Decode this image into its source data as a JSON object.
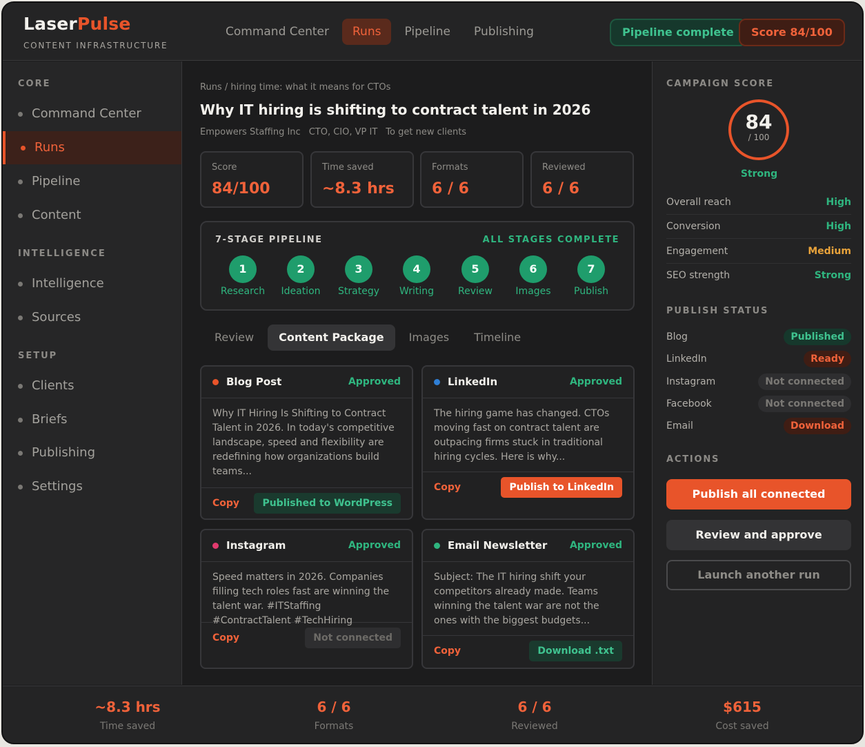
{
  "header": {
    "logo_part1": "Laser",
    "logo_part2": "Pulse",
    "logo_sub": "CONTENT INFRASTRUCTURE",
    "nav": [
      "Command Center",
      "Runs",
      "Pipeline",
      "Publishing"
    ],
    "active_nav": "Runs",
    "badge_pipeline": "Pipeline complete",
    "badge_score": "Score 84/100"
  },
  "sidebar": {
    "sections": [
      {
        "title": "CORE",
        "items": [
          "Command Center",
          "Runs",
          "Pipeline",
          "Content"
        ]
      },
      {
        "title": "INTELLIGENCE",
        "items": [
          "Intelligence",
          "Sources"
        ]
      },
      {
        "title": "SETUP",
        "items": [
          "Clients",
          "Briefs",
          "Publishing",
          "Settings"
        ]
      }
    ],
    "active_item": "Runs"
  },
  "main": {
    "breadcrumb": "Runs / hiring time: what it means for CTOs",
    "title": "Why IT hiring is shifting to contract talent in 2026",
    "meta": [
      "Empowers Staffing Inc",
      "CTO, CIO, VP IT",
      "To get new clients"
    ],
    "stats": [
      {
        "label": "Score",
        "value": "84/100"
      },
      {
        "label": "Time saved",
        "value": "~8.3 hrs"
      },
      {
        "label": "Formats",
        "value": "6 / 6"
      },
      {
        "label": "Reviewed",
        "value": "6 / 6"
      }
    ],
    "pipeline": {
      "title": "7-STAGE PIPELINE",
      "status": "ALL STAGES COMPLETE",
      "stages": [
        {
          "num": "1",
          "name": "Research"
        },
        {
          "num": "2",
          "name": "Ideation"
        },
        {
          "num": "3",
          "name": "Strategy"
        },
        {
          "num": "4",
          "name": "Writing"
        },
        {
          "num": "5",
          "name": "Review"
        },
        {
          "num": "6",
          "name": "Images"
        },
        {
          "num": "7",
          "name": "Publish"
        }
      ]
    },
    "tabs": [
      "Review",
      "Content Package",
      "Images",
      "Timeline"
    ],
    "active_tab": "Content Package",
    "cards": [
      {
        "title": "Blog Post",
        "status": "Approved",
        "dot_color": "#e8542a",
        "body": "Why IT Hiring Is Shifting to Contract Talent in 2026. In today's competitive landscape, speed and flexibility are redefining how organizations build teams...",
        "copy": "Copy",
        "action": "Published to WordPress",
        "action_style": "green"
      },
      {
        "title": "LinkedIn",
        "status": "Approved",
        "dot_color": "#2f7fd6",
        "body": "The hiring game has changed. CTOs moving fast on contract talent are outpacing firms stuck in traditional hiring cycles. Here is why...",
        "copy": "Copy",
        "action": "Publish to LinkedIn",
        "action_style": "orange"
      },
      {
        "title": "Instagram",
        "status": "Approved",
        "dot_color": "#e23a6e",
        "body": "Speed matters in 2026. Companies filling tech roles fast are winning the talent war. #ITStaffing #ContractTalent #TechHiring",
        "copy": "Copy",
        "action": "Not connected",
        "action_style": "grey"
      },
      {
        "title": "Email Newsletter",
        "status": "Approved",
        "dot_color": "#2fb57f",
        "body": "Subject: The IT hiring shift your competitors already made. Teams winning the talent war are not the ones with the biggest budgets...",
        "copy": "Copy",
        "action": "Download .txt",
        "action_style": "green"
      }
    ]
  },
  "right": {
    "campaign_title": "CAMPAIGN SCORE",
    "score": "84",
    "score_max": "/ 100",
    "score_label": "Strong",
    "metrics": [
      {
        "label": "Overall reach",
        "value": "High",
        "color": "#2fb57f"
      },
      {
        "label": "Conversion",
        "value": "High",
        "color": "#2fb57f"
      },
      {
        "label": "Engagement",
        "value": "Medium",
        "color": "#e8a23a"
      },
      {
        "label": "SEO strength",
        "value": "Strong",
        "color": "#2fb57f"
      }
    ],
    "publish_title": "PUBLISH STATUS",
    "publish": [
      {
        "label": "Blog",
        "value": "Published",
        "style": "green"
      },
      {
        "label": "LinkedIn",
        "value": "Ready",
        "style": "orange"
      },
      {
        "label": "Instagram",
        "value": "Not connected",
        "style": "grey"
      },
      {
        "label": "Facebook",
        "value": "Not connected",
        "style": "grey"
      },
      {
        "label": "Email",
        "value": "Download",
        "style": "orange"
      }
    ],
    "actions_title": "ACTIONS",
    "btn_publish_all": "Publish all connected",
    "btn_review": "Review and approve",
    "btn_launch": "Launch another run"
  },
  "footer": [
    {
      "value": "~8.3 hrs",
      "label": "Time saved"
    },
    {
      "value": "6 / 6",
      "label": "Formats"
    },
    {
      "value": "6 / 6",
      "label": "Reviewed"
    },
    {
      "value": "$615",
      "label": "Cost saved"
    }
  ]
}
